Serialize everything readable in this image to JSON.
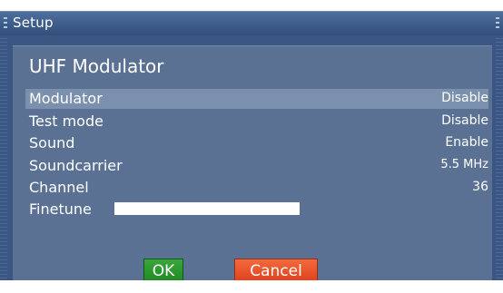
{
  "window": {
    "title": "Setup"
  },
  "panel": {
    "title": "UHF Modulator",
    "rows": [
      {
        "label": "Modulator",
        "value": "Disable"
      },
      {
        "label": "Test mode",
        "value": "Disable"
      },
      {
        "label": "Sound",
        "value": "Enable"
      },
      {
        "label": "Soundcarrier",
        "value": "5.5 MHz"
      },
      {
        "label": "Channel",
        "value": "36"
      },
      {
        "label": "Finetune",
        "value": ""
      }
    ],
    "selected_row": "Modulator"
  },
  "buttons": {
    "ok_label": "OK",
    "cancel_label": "Cancel"
  },
  "colors": {
    "ok": "#1f8a23",
    "cancel": "#e0421d",
    "selection": "#7b90ad"
  }
}
